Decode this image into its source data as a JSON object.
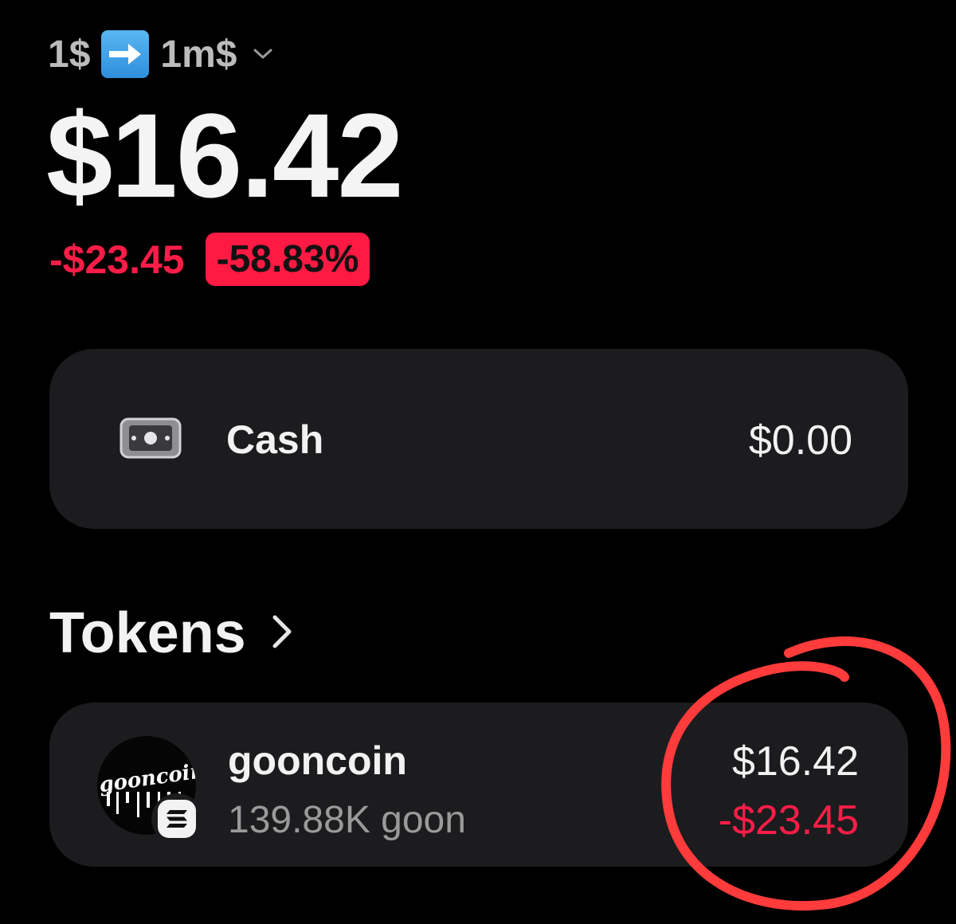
{
  "account": {
    "name_from": "1$",
    "name_to": "1m$",
    "arrow_icon": "right-arrow-emoji",
    "chevron_icon": "chevron-down-icon"
  },
  "portfolio": {
    "balance": "$16.42",
    "change_amount": "-$23.45",
    "change_percent": "-58.83%"
  },
  "cash": {
    "icon": "cash-icon",
    "label": "Cash",
    "value": "$0.00"
  },
  "tokens": {
    "title": "Tokens",
    "chevron_icon": "chevron-right-icon",
    "items": [
      {
        "name": "gooncoin",
        "logo_text": "gooncoin",
        "chain_icon": "solana-icon",
        "quantity": "139.88K goon",
        "value": "$16.42",
        "change": "-$23.45"
      }
    ]
  },
  "colors": {
    "background": "#000000",
    "card": "#1c1c1e",
    "negative": "#ff1d48",
    "badge": "#ff1a44",
    "annotation": "#ff3b3b"
  }
}
